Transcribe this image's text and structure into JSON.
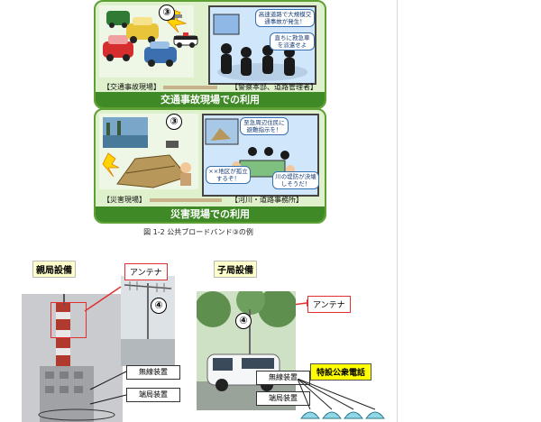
{
  "figure": {
    "panels": [
      {
        "banner": "交通事故現場での利用",
        "left_label": "【交通事故現場】",
        "right_label": "【警察本部、道路管理者】",
        "bubble_top": "高速道路で大規模交通事故が発生！",
        "bubble_bottom": "直ちに救急車を派遣せよ"
      },
      {
        "banner": "災害現場での利用",
        "left_label": "【災害現場】",
        "right_label": "【河川・道路事務所】",
        "bubble_top": "至急周辺住民に避難指示を！",
        "bubble_left": "××地区が孤立するぞ！",
        "bubble_right": "川の堤防が決壊しそうだ！"
      }
    ],
    "circled_num": "③"
  },
  "caption": "図 1-2  公共ブロードバンド③の例",
  "parent_station": {
    "title": "親局設備",
    "antenna": "アンテナ",
    "circled_num": "④",
    "equip": [
      "無線装置",
      "端局装置"
    ]
  },
  "child_station": {
    "title": "子局設備",
    "antenna": "アンテナ",
    "circled_num": "④",
    "equip": [
      "無線装置",
      "端局装置"
    ],
    "public_phone": "特設公衆電話"
  },
  "colors": {
    "panel_bg": "#dff0cc",
    "banner": "#3f8a26",
    "red": "#e23030",
    "yellow": "#ffff00"
  }
}
